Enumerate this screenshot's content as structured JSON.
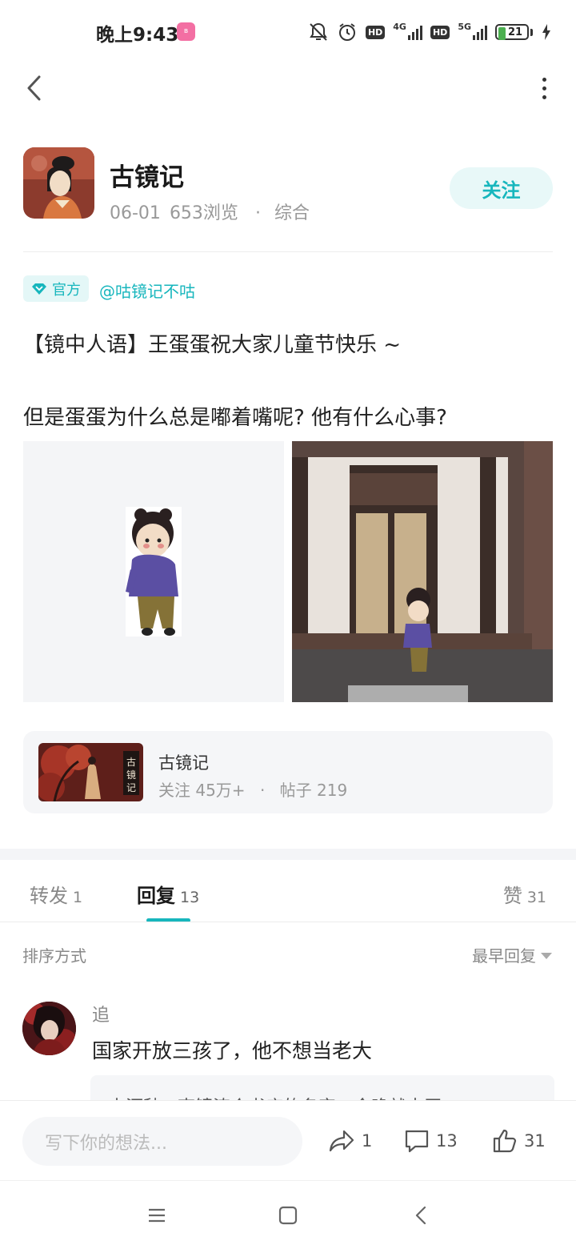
{
  "status_bar": {
    "time": "晚上9:43",
    "app_badge": "bilibili",
    "hd_1": "HD",
    "net_1": "4G",
    "hd_2": "HD",
    "net_2": "5G",
    "battery": "21"
  },
  "author": {
    "name": "古镜记",
    "date": "06-01",
    "views": "653浏览",
    "dot": "·",
    "category": "综合",
    "follow_label": "关注"
  },
  "tags": {
    "official": "官方",
    "mention": "@咕镜记不咕"
  },
  "post": {
    "line_1": "【镜中人语】王蛋蛋祝大家儿童节快乐 ~",
    "line_2": "但是蛋蛋为什么总是嘟着嘴呢? 他有什么心事?"
  },
  "circle": {
    "name": "古镜记",
    "followers": "关注 45万+",
    "dot": "·",
    "posts": "帖子 219",
    "seal_text": "古镜记"
  },
  "tabs": {
    "repost_label": "转发",
    "repost_count": "1",
    "reply_label": "回复",
    "reply_count": "13",
    "like_label": "赞",
    "like_count": "31"
  },
  "sort": {
    "label": "排序方式",
    "selected": "最早回复"
  },
  "comment": {
    "user": "追",
    "text": "国家开放三孩了，他不想当老大",
    "reply_preview": "来源秋 ·    李镜涛个书店的名字，今晚就去买"
  },
  "bottom_bar": {
    "input_placeholder": "写下你的想法...",
    "share_count": "1",
    "comment_count": "13",
    "like_count": "31"
  },
  "colors": {
    "accent": "#17b6bd",
    "accent_light": "#e8f8f8"
  }
}
